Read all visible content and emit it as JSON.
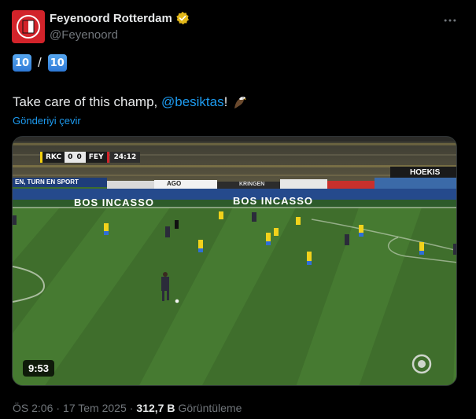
{
  "author": {
    "display_name": "Feyenoord Rotterdam",
    "handle": "@Feyenoord",
    "verified_icon": "verified-badge-icon",
    "avatar_color": "#d2232a"
  },
  "tweet": {
    "keycap_left": "10",
    "separator": "/",
    "keycap_right": "10",
    "text_before": "Take care of this champ, ",
    "mention": "@besiktas",
    "text_after": "!",
    "translate_label": "Gönderiyi çevir"
  },
  "video": {
    "scoreboard": {
      "team_home": "RKC",
      "score": "0 0",
      "team_away": "FEY",
      "clock": "24:12"
    },
    "ad_boards": {
      "left": "BOS INCASSO",
      "right": "BOS INCASSO",
      "top_right": "HOEKIS",
      "stand_banner": "EN, TURN EN SPORT",
      "board_mid": "AGO",
      "board_mid2": "KRINGEN"
    },
    "duration": "9:53",
    "pitch_color": "#3f6e2c"
  },
  "meta": {
    "time": "ÖS 2:06",
    "dot1": "·",
    "date": "17 Tem 2025",
    "dot2": "·",
    "views_count": "312,7 B",
    "views_label": "Görüntüleme"
  }
}
